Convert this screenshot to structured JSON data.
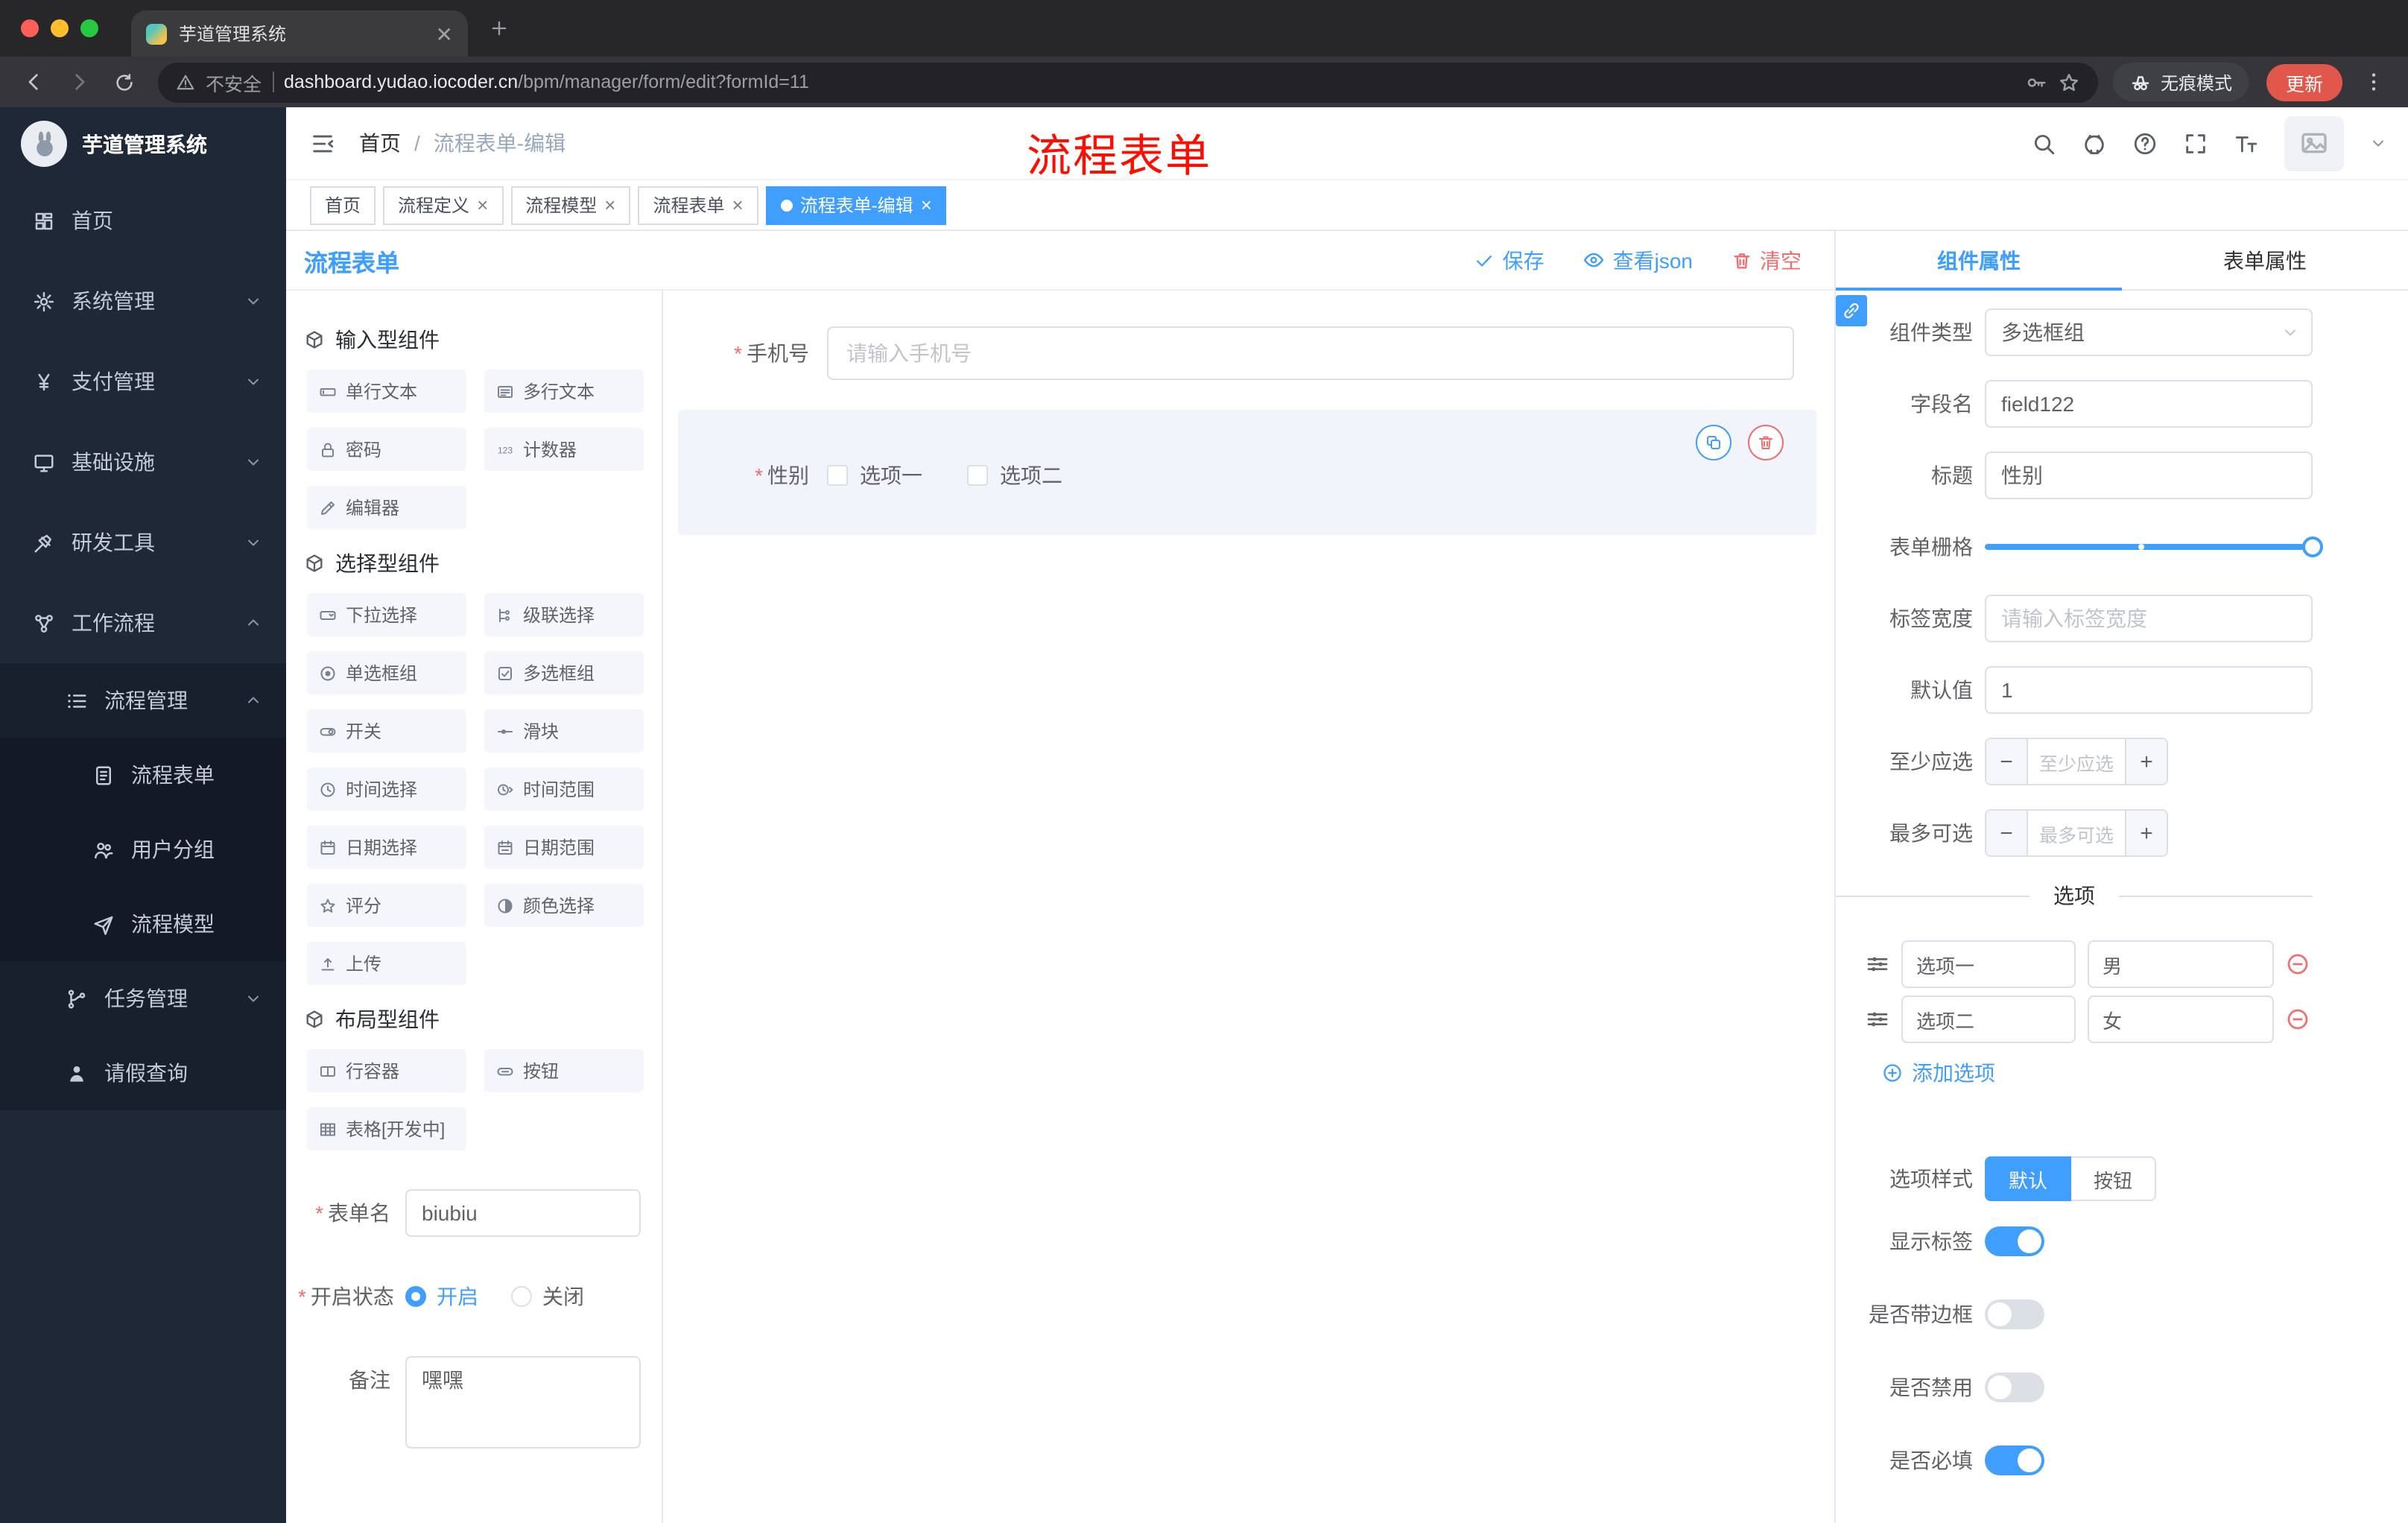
{
  "theme": {
    "accent": "#409eff",
    "danger": "#f56c6c",
    "sidebar_bg": "#1e2837",
    "update_btn": "#e1574b"
  },
  "chrome": {
    "tab": {
      "title": "芋道管理系统",
      "favicon": "yudao-favicon"
    },
    "toolbar": {
      "security_label": "不安全",
      "url_host": "dashboard.yudao.iocoder.cn",
      "url_path": "/bpm/manager/form/edit?formId=11",
      "incognito_label": "无痕模式",
      "update_label": "更新"
    }
  },
  "sidebar": {
    "logo_title": "芋道管理系统",
    "items": [
      {
        "label": "首页",
        "icon": "home-icon"
      },
      {
        "label": "系统管理",
        "icon": "gear-icon",
        "chevron": "down"
      },
      {
        "label": "支付管理",
        "icon": "yen-icon",
        "chevron": "down"
      },
      {
        "label": "基础设施",
        "icon": "monitor-icon",
        "chevron": "down"
      },
      {
        "label": "研发工具",
        "icon": "tool-icon",
        "chevron": "down"
      },
      {
        "label": "工作流程",
        "icon": "workflow-icon",
        "chevron": "up"
      },
      {
        "label": "流程管理",
        "icon": "list-icon",
        "chevron": "up"
      },
      {
        "label": "流程表单",
        "icon": "form-icon"
      },
      {
        "label": "用户分组",
        "icon": "users-icon"
      },
      {
        "label": "流程模型",
        "icon": "send-icon"
      },
      {
        "label": "任务管理",
        "icon": "task-icon",
        "chevron": "down"
      },
      {
        "label": "请假查询",
        "icon": "person-icon"
      }
    ]
  },
  "header": {
    "breadcrumb": {
      "root": "首页",
      "separator": "/",
      "current": "流程表单-编辑"
    },
    "overlay_title": "流程表单"
  },
  "tags": [
    {
      "label": "首页",
      "closable": false,
      "active": false
    },
    {
      "label": "流程定义",
      "closable": true,
      "active": false
    },
    {
      "label": "流程模型",
      "closable": true,
      "active": false
    },
    {
      "label": "流程表单",
      "closable": true,
      "active": false
    },
    {
      "label": "流程表单-编辑",
      "closable": true,
      "active": true
    }
  ],
  "designer": {
    "title": "流程表单",
    "actions": {
      "save": "保存",
      "view_json": "查看json",
      "clear": "清空"
    },
    "groups": [
      {
        "title": "输入型组件",
        "items": [
          {
            "label": "单行文本",
            "icon": "#i-inputline"
          },
          {
            "label": "多行文本",
            "icon": "#i-textarea"
          },
          {
            "label": "密码",
            "icon": "#i-lock"
          },
          {
            "label": "计数器",
            "icon": "#i-counter"
          },
          {
            "label": "编辑器",
            "icon": "#i-edit"
          }
        ]
      },
      {
        "title": "选择型组件",
        "items": [
          {
            "label": "下拉选择",
            "icon": "#i-select"
          },
          {
            "label": "级联选择",
            "icon": "#i-cascade"
          },
          {
            "label": "单选框组",
            "icon": "#i-radiogrp"
          },
          {
            "label": "多选框组",
            "icon": "#i-checksq"
          },
          {
            "label": "开关",
            "icon": "#i-switchpill"
          },
          {
            "label": "滑块",
            "icon": "#i-sliderline"
          },
          {
            "label": "时间选择",
            "icon": "#i-clock"
          },
          {
            "label": "时间范围",
            "icon": "#i-timerange"
          },
          {
            "label": "日期选择",
            "icon": "#i-cal"
          },
          {
            "label": "日期范围",
            "icon": "#i-calrange"
          },
          {
            "label": "评分",
            "icon": "#i-star"
          },
          {
            "label": "颜色选择",
            "icon": "#i-color"
          },
          {
            "label": "上传",
            "icon": "#i-upload"
          }
        ]
      },
      {
        "title": "布局型组件",
        "items": [
          {
            "label": "行容器",
            "icon": "#i-rowbox"
          },
          {
            "label": "按钮",
            "icon": "#i-btn"
          },
          {
            "label": "表格[开发中]",
            "icon": "#i-tablegrid"
          }
        ]
      }
    ],
    "meta": {
      "name_label": "表单名",
      "name_value": "biubiu",
      "status_label": "开启状态",
      "status_on": "开启",
      "status_on_checked": true,
      "status_off": "关闭",
      "remark_label": "备注",
      "remark_value": "嘿嘿"
    },
    "canvas": {
      "phone": {
        "label": "手机号",
        "placeholder": "请输入手机号"
      },
      "gender": {
        "label": "性别",
        "options": [
          "选项一",
          "选项二"
        ],
        "selected": true
      }
    }
  },
  "props": {
    "tab_component": "组件属性",
    "tab_form": "表单属性",
    "active_tab": "组件属性",
    "rows": {
      "type": {
        "label": "组件类型",
        "value": "多选框组"
      },
      "field": {
        "label": "字段名",
        "value": "field122"
      },
      "title": {
        "label": "标题",
        "value": "性别"
      },
      "grid": {
        "label": "表单栅格"
      },
      "label_width": {
        "label": "标签宽度",
        "placeholder": "请输入标签宽度"
      },
      "default": {
        "label": "默认值",
        "value": "1"
      },
      "min": {
        "label": "至少应选",
        "placeholder": "至少应选"
      },
      "max": {
        "label": "最多可选",
        "placeholder": "最多可选"
      }
    },
    "divider": "选项",
    "options": [
      {
        "label": "选项一",
        "value": "男"
      },
      {
        "label": "选项二",
        "value": "女"
      }
    ],
    "add_option": "添加选项",
    "style": {
      "label": "选项样式",
      "default_btn": "默认",
      "default_active": true,
      "button_btn": "按钮"
    },
    "switches": {
      "show_label": {
        "label": "显示标签",
        "on": true
      },
      "border": {
        "label": "是否带边框",
        "on": false
      },
      "disabled": {
        "label": "是否禁用",
        "on": false
      },
      "required": {
        "label": "是否必填",
        "on": true
      }
    }
  }
}
